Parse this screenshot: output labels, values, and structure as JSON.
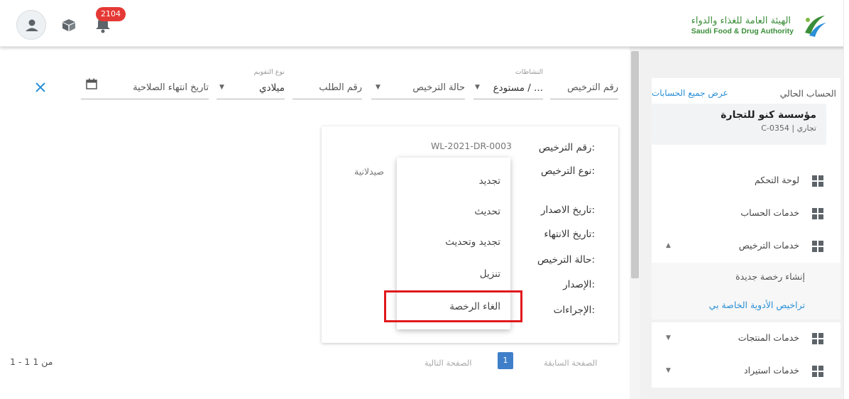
{
  "header": {
    "notification_count": "2104",
    "logo_ar": "الهيئة العامة للغذاء والدواء",
    "logo_en": "Saudi Food & Drug Authority"
  },
  "sidebar": {
    "current_account_label": "الحساب الحالي",
    "view_all_accounts": "عرض جميع الحسابات",
    "org_name": "مؤسسة كنو للتجارة",
    "org_meta": "C-0354 | تجاري",
    "items": [
      {
        "label": "لوحة التحكم"
      },
      {
        "label": "خدمات الحساب"
      },
      {
        "label": "خدمات الترخيص"
      }
    ],
    "sub_items": [
      {
        "label": "إنشاء رخصة جديدة"
      },
      {
        "label": "تراخيص الأدوية الخاصة بي"
      }
    ],
    "more_items": [
      {
        "label": "خدمات المنتجات"
      },
      {
        "label": "خدمات استيراد"
      }
    ]
  },
  "filters": {
    "license_number": "رقم الترخيص",
    "activities_label": "النشاطات",
    "activities_value": "مستودع / ...",
    "license_status": "حالة الترخيص",
    "request_number": "رقم الطلب",
    "calendar_type_label": "نوع التقويم",
    "calendar_type_value": "ميلادي",
    "expiry_date": "تاريخ انتهاء الصلاحية"
  },
  "card": {
    "license_number_label": "رقم الترخيص:",
    "license_number_value": "WL-2021-DR-0003",
    "license_type_label": "نوع الترخيص:",
    "license_type_value": "صيدلانية",
    "issue_date_label": "تاريخ الاصدار:",
    "expiry_date_label": "تاريخ الانتهاء:",
    "status_label": "حالة الترخيص:",
    "version_label": "الإصدار:",
    "actions_label": "الإجراءات:"
  },
  "actions_menu": {
    "renew": "تجديد",
    "update": "تحديث",
    "renew_update": "تجديد وتحديث",
    "download": "تنزيل",
    "cancel_license": "الغاء الرخصة"
  },
  "pagination": {
    "previous": "الصفحة السابقة",
    "current_page": "1",
    "next": "الصفحة التالية",
    "count": "1 - 1 من 1"
  },
  "colors": {
    "accent": "#3f7fc9",
    "link": "#2a8fd6",
    "badge": "#e53935",
    "highlight": "#e0191e",
    "logo_green": "#3a8e39"
  }
}
